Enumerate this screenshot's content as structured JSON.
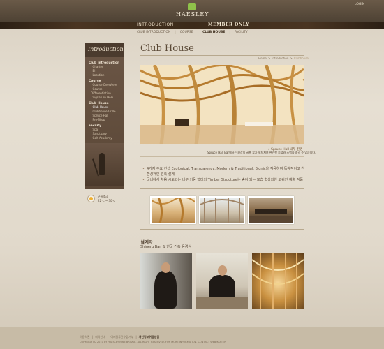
{
  "brand": {
    "name": "HAESLEY",
    "login_label": "LOGIN"
  },
  "nav": {
    "intro_label": "INTRODUCTION",
    "member_label": "MEMBER ONLY"
  },
  "subnav": {
    "items": [
      "CLUB INTRODUCTION",
      "COURSE",
      "CLUB HOUSE",
      "FACILITY"
    ],
    "active_index": 2
  },
  "sidebar": {
    "title": "Introduction",
    "sections": [
      {
        "label": "Club Introduction",
        "items": [
          "Charter",
          "BI",
          "Location"
        ]
      },
      {
        "label": "Course",
        "items": [
          "Course OverView",
          "Course Differentiation",
          "Signature Hole"
        ]
      },
      {
        "label": "Club House",
        "items": [
          "Club House",
          "Clubhouse Grille",
          "Spruce Hall",
          "Pro-Shop"
        ],
        "active_item": "Club House"
      },
      {
        "label": "Facility",
        "items": [
          "Spa",
          "Sanctuary",
          "Golf Academy"
        ]
      }
    ]
  },
  "side_widget": {
    "line1": "구름조금",
    "line2": "22℃ ~ 30℃"
  },
  "page": {
    "title": "Club House",
    "breadcrumb": [
      "Home",
      "Introduction",
      "Clubhouse"
    ],
    "caption_title": "» Spruce Hall 내부 전경",
    "caption_text": "Spruce Hall Bar에서는 환상의 골프 뷰가 펼쳐지며 편안한 음료와 스낵을 즐길 수 있습니다.",
    "bullets": [
      "4가지 주요 컨셉 Ecological, Transparency, Modern & Traditional, Bionic을 적용하여 독창적이고 친환경적인 건축 설계",
      "국내에서 처음 시도되는 나무 기둥 형태의 Timber Structure는 숲이 되는 모습 형상화한 고귀한 예술 작품"
    ],
    "designer_title": "설계자",
    "designer_sub": "Shigeru Ban & 한국 건축 용경식"
  },
  "footer": {
    "links": [
      "이용약관",
      "회칙안내",
      "이메일무단수집거부",
      "개인정보취급방침"
    ],
    "copyright": "COPYRIGHT© 2010 BY HAESLEY NINE BRIDGE. ALL RIGHT RESERVED. FOR MORE INFORMATION, CONTACT WEBMASTER"
  }
}
